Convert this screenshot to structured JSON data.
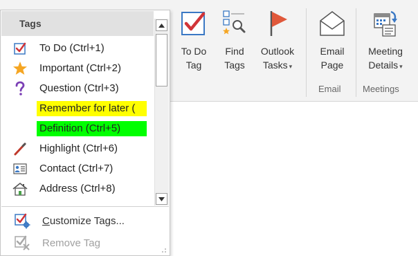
{
  "ribbon": {
    "buttons": [
      {
        "id": "todo",
        "line1": "To Do",
        "line2": "Tag",
        "dropdown": false,
        "icon": "todo-checkbox-icon"
      },
      {
        "id": "find",
        "line1": "Find",
        "line2": "Tags",
        "dropdown": false,
        "icon": "find-tags-icon"
      },
      {
        "id": "outlook",
        "line1": "Outlook",
        "line2": "Tasks",
        "dropdown": true,
        "icon": "outlook-flag-icon"
      },
      {
        "id": "email",
        "line1": "Email",
        "line2": "Page",
        "dropdown": false,
        "icon": "email-envelope-icon"
      },
      {
        "id": "meeting",
        "line1": "Meeting",
        "line2": "Details",
        "dropdown": true,
        "icon": "meeting-calendar-icon"
      }
    ],
    "groups": {
      "email": "Email",
      "meetings": "Meetings"
    },
    "dropdown_arrow": "▾"
  },
  "tags_menu": {
    "title": "Tags",
    "items": [
      {
        "label": "To Do (Ctrl+1)",
        "icon": "checkbox-icon",
        "highlight": null
      },
      {
        "label": "Important (Ctrl+2)",
        "icon": "star-icon",
        "highlight": null
      },
      {
        "label": "Question (Ctrl+3)",
        "icon": "question-icon",
        "highlight": null
      },
      {
        "label": "Remember for later (",
        "icon": null,
        "highlight": "#ffff00"
      },
      {
        "label": "Definition (Ctrl+5)",
        "icon": null,
        "highlight": "#00ff00"
      },
      {
        "label": "Highlight (Ctrl+6)",
        "icon": "pen-icon",
        "highlight": null
      },
      {
        "label": "Contact (Ctrl+7)",
        "icon": "contact-card-icon",
        "highlight": null
      },
      {
        "label": "Address (Ctrl+8)",
        "icon": "house-icon",
        "highlight": null
      }
    ],
    "customize_label": "Customize Tags...",
    "customize_underline": "C",
    "remove_label": "Remove Tag"
  },
  "colors": {
    "red_check": "#d13438",
    "star": "#f5a623",
    "question": "#7b3fb5",
    "flag": "#e0583a",
    "blue": "#2e6fbf"
  }
}
